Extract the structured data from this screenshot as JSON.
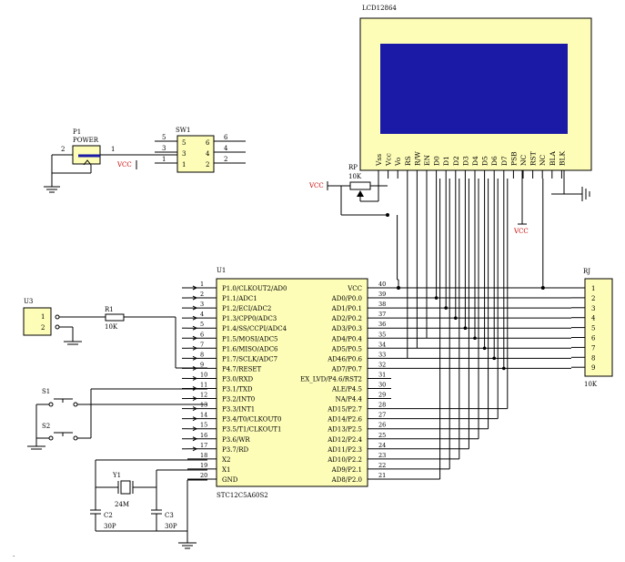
{
  "lcd": {
    "title": "LCD12864",
    "screen_color": "#1a1aa6",
    "body_color": "#fdfdb8",
    "pins": [
      "Vss",
      "Vcc",
      "Vo",
      "RS",
      "R/W",
      "EN",
      "D0",
      "D1",
      "D2",
      "D3",
      "D4",
      "D5",
      "D6",
      "D7",
      "PSB",
      "NC",
      "RST",
      "NC",
      "BLA",
      "BLK"
    ]
  },
  "rp": {
    "ref": "RP",
    "value": "10K",
    "vcc": "VCC"
  },
  "psb_vcc": "VCC",
  "p1": {
    "ref": "P1",
    "name": "POWER",
    "pin1": "1",
    "pin2": "2"
  },
  "sw1": {
    "ref": "SW1",
    "pins_left": [
      "5",
      "3",
      "1"
    ],
    "pins_right": [
      "6",
      "4",
      "2"
    ],
    "inner_left": [
      "5",
      "3",
      "1"
    ],
    "inner_right": [
      "6",
      "4",
      "2"
    ],
    "vcc": "VCC"
  },
  "u3": {
    "ref": "U3",
    "pins": [
      "1",
      "2"
    ]
  },
  "r1": {
    "ref": "R1",
    "value": "10K"
  },
  "u1": {
    "ref": "U1",
    "part": "STC12C5A60S2",
    "left_pins": [
      {
        "num": "1",
        "name": "P1.0/CLKOUT2/AD0"
      },
      {
        "num": "2",
        "name": "P1.1/ADC1"
      },
      {
        "num": "3",
        "name": "P1.2/ECI/ADC2"
      },
      {
        "num": "4",
        "name": "P1.3/CPP0/ADC3"
      },
      {
        "num": "5",
        "name": "P1.4/SS/CCPI/ADC4"
      },
      {
        "num": "6",
        "name": "P1.5/MOSI/ADC5"
      },
      {
        "num": "7",
        "name": "P1.6/MISO/ADC6"
      },
      {
        "num": "8",
        "name": "P1.7/SCLK/ADC7"
      },
      {
        "num": "9",
        "name": "P4.7/RESET"
      },
      {
        "num": "10",
        "name": "P3.0/RXD"
      },
      {
        "num": "11",
        "name": "P3.1/TXD"
      },
      {
        "num": "12",
        "name": "P3.2/INT0"
      },
      {
        "num": "13",
        "name": "P3.3/INT1"
      },
      {
        "num": "14",
        "name": "P3.4/T0/CLKOUT0"
      },
      {
        "num": "15",
        "name": "P3.5/T1/CLKOUT1"
      },
      {
        "num": "16",
        "name": "P3.6/WR"
      },
      {
        "num": "17",
        "name": "P3.7/RD"
      },
      {
        "num": "18",
        "name": "X2"
      },
      {
        "num": "19",
        "name": "X1"
      },
      {
        "num": "20",
        "name": "GND"
      }
    ],
    "right_pins": [
      {
        "num": "40",
        "name": "VCC"
      },
      {
        "num": "39",
        "name": "AD0/P0.0"
      },
      {
        "num": "38",
        "name": "AD1/P0.1"
      },
      {
        "num": "37",
        "name": "AD2/P0.2"
      },
      {
        "num": "36",
        "name": "AD3/P0.3"
      },
      {
        "num": "35",
        "name": "AD4/P0.4"
      },
      {
        "num": "34",
        "name": "AD5/P0.5"
      },
      {
        "num": "33",
        "name": "AD46/P0.6"
      },
      {
        "num": "32",
        "name": "AD7/P0.7"
      },
      {
        "num": "31",
        "name": "EX_LVD/P4.6/RST2"
      },
      {
        "num": "30",
        "name": "ALE/P4.5"
      },
      {
        "num": "29",
        "name": "NA/P4.4"
      },
      {
        "num": "28",
        "name": "AD15/P2.7"
      },
      {
        "num": "27",
        "name": "AD14/P2.6"
      },
      {
        "num": "26",
        "name": "AD13/P2.5"
      },
      {
        "num": "25",
        "name": "AD12/P2.4"
      },
      {
        "num": "24",
        "name": "AD11/P2.3"
      },
      {
        "num": "23",
        "name": "AD10/P2.2"
      },
      {
        "num": "22",
        "name": "AD9/P2.1"
      },
      {
        "num": "21",
        "name": "AD8/P2.0"
      }
    ]
  },
  "rj": {
    "ref": "RJ",
    "value": "10K",
    "pins": [
      "1",
      "2",
      "3",
      "4",
      "5",
      "6",
      "7",
      "8",
      "9"
    ]
  },
  "s1": {
    "ref": "S1"
  },
  "s2": {
    "ref": "S2"
  },
  "y1": {
    "ref": "Y1",
    "value": "24M"
  },
  "c2": {
    "ref": "C2",
    "value": "30P"
  },
  "c3": {
    "ref": "C3",
    "value": "30P"
  },
  "corner_mark": "."
}
